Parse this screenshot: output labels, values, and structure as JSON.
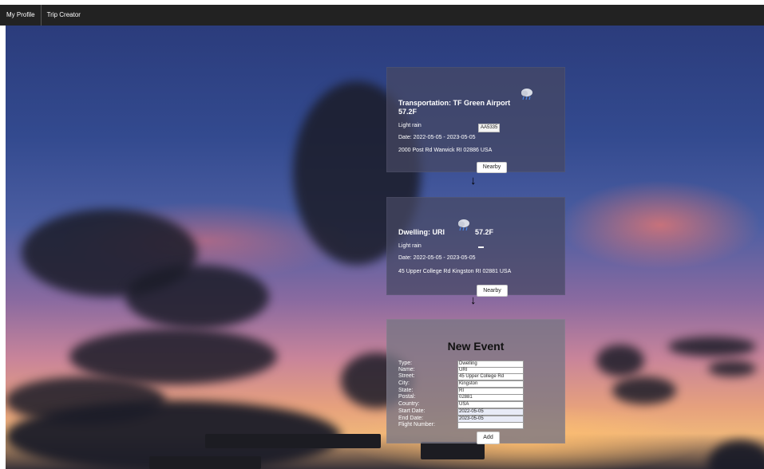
{
  "nav": {
    "profile": "My Profile",
    "trip_creator": "Trip Creator"
  },
  "cards": [
    {
      "title": "Transportation: TF Green Airport",
      "temperature": "57.2F",
      "condition": "Light rain",
      "flight": "AA5335",
      "date": "Date: 2022-05-05 - 2023-05-05",
      "address": "2000 Post Rd Warwick RI 02886 USA",
      "button": "Nearby",
      "icon": "rain-cloud-icon"
    },
    {
      "title": "Dwelling: URI",
      "temperature": "57.2F",
      "condition": "Light rain",
      "date": "Date: 2022-05-05 - 2023-05-05",
      "address": "45 Upper College Rd Kingston RI 02881 USA",
      "button": "Nearby",
      "icon": "rain-cloud-icon"
    }
  ],
  "form": {
    "title": "New Event",
    "labels": {
      "type": "Type:",
      "name": "Name:",
      "street": "Street:",
      "city": "City:",
      "state": "State:",
      "postal": "Postal:",
      "country": "Country:",
      "start": "Start Date:",
      "end": "End Date:",
      "flight": "Flight Number:"
    },
    "values": {
      "type": "Dwelling",
      "name": "URI",
      "street": "45 Upper College Rd",
      "city": "Kingston",
      "state": "RI",
      "postal": "02881",
      "country": "USA",
      "start": "2022-05-05",
      "end": "2023-05-05",
      "flight": ""
    },
    "submit": "Add"
  },
  "arrow": "↓"
}
